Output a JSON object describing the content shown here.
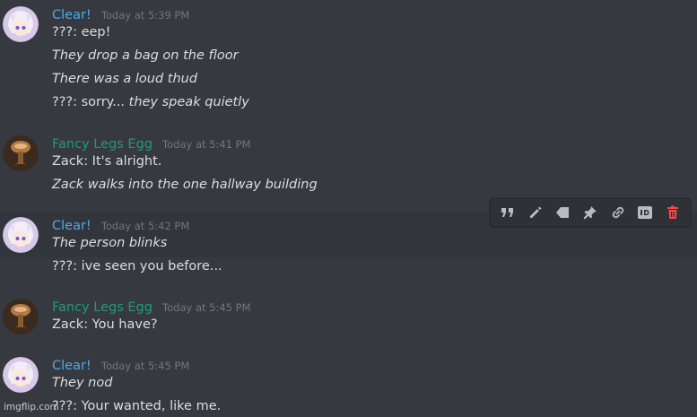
{
  "colors": {
    "background": "#36393f",
    "clear_name": "#4fa9e6",
    "fancy_name": "#1f9d73",
    "timestamp": "#72767d",
    "delete_icon": "#f04747"
  },
  "messages": [
    {
      "author": "Clear!",
      "avatar": "anime-girl-avatar",
      "timestamp": "Today at 5:39 PM",
      "lines": [
        {
          "text": "???: eep!"
        },
        {
          "text": "They drop a bag on the floor"
        },
        {
          "text": "There was a loud thud"
        },
        {
          "prefix": "???: sorry... ",
          "text": "they speak quietly"
        }
      ]
    },
    {
      "author": "Fancy Legs Egg",
      "avatar": "egg-legs-avatar",
      "timestamp": "Today at 5:41 PM",
      "lines": [
        {
          "text": "Zack: It's alright."
        },
        {
          "text": "Zack walks into the one hallway building"
        }
      ]
    },
    {
      "author": "Clear!",
      "avatar": "anime-girl-avatar",
      "timestamp": "Today at 5:42 PM",
      "lines": [
        {
          "text": "The person blinks"
        },
        {
          "text": "???: ive seen you before..."
        }
      ]
    },
    {
      "author": "Fancy Legs Egg",
      "avatar": "egg-legs-avatar",
      "timestamp": "Today at 5:45 PM",
      "lines": [
        {
          "text": "Zack: You have?"
        }
      ]
    },
    {
      "author": "Clear!",
      "avatar": "anime-girl-avatar",
      "timestamp": "Today at 5:45 PM",
      "lines": [
        {
          "text": "They nod"
        },
        {
          "text": "???: Your wanted, like me."
        }
      ]
    }
  ],
  "toolbar": {
    "icons": [
      "quote-icon",
      "edit-icon",
      "tag-icon",
      "pin-icon",
      "link-icon",
      "id-icon",
      "delete-icon"
    ]
  },
  "watermark": "imgflip.com"
}
